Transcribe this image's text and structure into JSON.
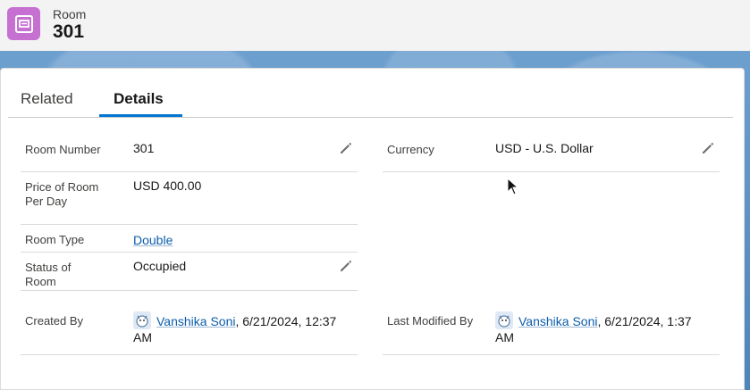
{
  "header": {
    "object_type": "Room",
    "record_name": "301",
    "icon": "room-record-icon",
    "icon_color": "#c670d2"
  },
  "tabs": [
    {
      "label": "Related",
      "active": false
    },
    {
      "label": "Details",
      "active": true
    }
  ],
  "fields": {
    "room_number": {
      "label": "Room Number",
      "value": "301"
    },
    "currency": {
      "label": "Currency",
      "value": "USD - U.S. Dollar"
    },
    "price_per_day": {
      "label": "Price of Room Per Day",
      "value": "USD 400.00"
    },
    "room_type": {
      "label": "Room Type",
      "value": "Double"
    },
    "status": {
      "label": "Status of Room",
      "value": "Occupied"
    },
    "created_by": {
      "label": "Created By",
      "user": "Vanshika Soni",
      "datetime_line1": ", 6/21/2024, 12:37",
      "datetime_line2": "AM"
    },
    "last_modified_by": {
      "label": "Last Modified By",
      "user": "Vanshika Soni",
      "datetime_line1": ", 6/21/2024, 1:37",
      "datetime_line2": "AM"
    }
  },
  "colors": {
    "accent": "#0176d3",
    "link": "#0b5cab",
    "band": "#5a8fc3"
  }
}
